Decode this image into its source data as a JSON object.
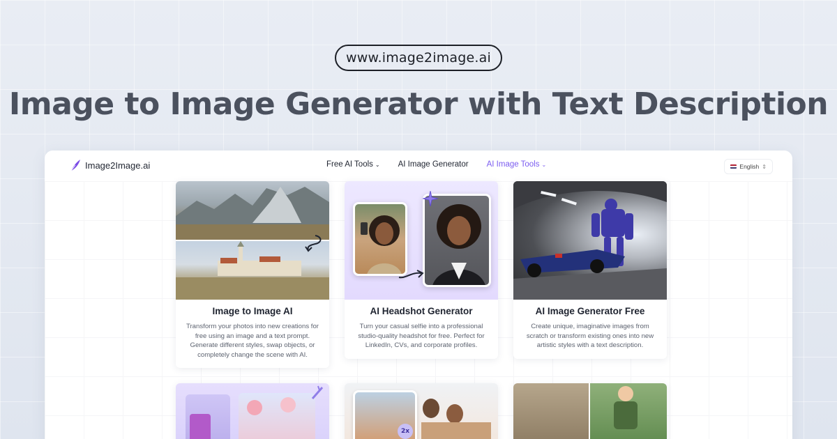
{
  "header": {
    "url": "www.image2image.ai",
    "headline": "Image to Image Generator with Text Description"
  },
  "navbar": {
    "logo_text": "Image2Image.ai",
    "links": [
      {
        "label": "Free AI Tools",
        "has_dropdown": true,
        "active": false
      },
      {
        "label": "AI Image Generator",
        "has_dropdown": false,
        "active": false
      },
      {
        "label": "AI Image Tools",
        "has_dropdown": true,
        "active": true
      }
    ],
    "language": "English",
    "accent_color": "#7b5cf0"
  },
  "cards": [
    {
      "title": "Image to Image AI",
      "description": "Transform your photos into new creations for free using an image and a text prompt. Generate different styles, swap objects, or completely change the scene with AI.",
      "image_icon": "landscape-transform-image"
    },
    {
      "title": "AI Headshot Generator",
      "description": "Turn your casual selfie into a professional studio-quality headshot for free. Perfect for LinkedIn, CVs, and corporate profiles.",
      "image_icon": "headshot-before-after-image"
    },
    {
      "title": "AI Image Generator Free",
      "description": "Create unique, imaginative images from scratch or transform existing ones into new artistic styles with a text description.",
      "image_icon": "robot-racecar-image"
    },
    {
      "title": "",
      "description": "",
      "image_icon": "perfume-flowers-image"
    },
    {
      "title": "",
      "description": "",
      "image_icon": "family-photo-upscale-image",
      "badge": "2x"
    },
    {
      "title": "",
      "description": "",
      "image_icon": "old-photo-restore-image"
    }
  ]
}
